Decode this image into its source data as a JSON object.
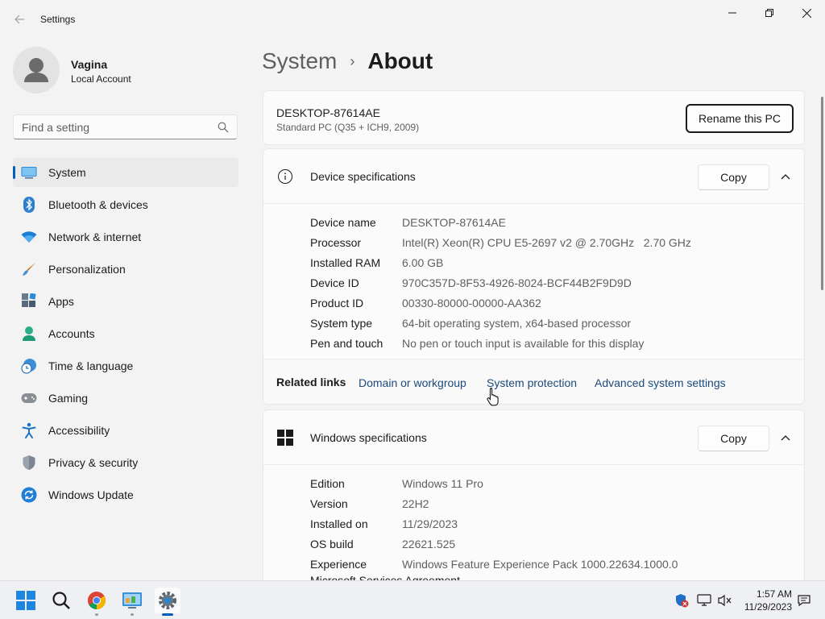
{
  "window": {
    "title": "Settings",
    "controls": {
      "minimize": "minimize-icon",
      "maximize": "restore-icon",
      "close": "close-icon"
    }
  },
  "profile": {
    "name": "Vagina",
    "account_type": "Local Account"
  },
  "search": {
    "placeholder": "Find a setting",
    "value": ""
  },
  "sidebar": {
    "items": [
      {
        "label": "System",
        "icon": "monitor-icon",
        "active": true
      },
      {
        "label": "Bluetooth & devices",
        "icon": "bluetooth-icon"
      },
      {
        "label": "Network & internet",
        "icon": "wifi-icon"
      },
      {
        "label": "Personalization",
        "icon": "brush-icon"
      },
      {
        "label": "Apps",
        "icon": "apps-icon"
      },
      {
        "label": "Accounts",
        "icon": "accounts-icon"
      },
      {
        "label": "Time & language",
        "icon": "globe-clock-icon"
      },
      {
        "label": "Gaming",
        "icon": "gamepad-icon"
      },
      {
        "label": "Accessibility",
        "icon": "accessibility-icon"
      },
      {
        "label": "Privacy & security",
        "icon": "shield-icon"
      },
      {
        "label": "Windows Update",
        "icon": "update-icon"
      }
    ]
  },
  "breadcrumb": {
    "parent": "System",
    "separator": "›",
    "current": "About"
  },
  "pc": {
    "name": "DESKTOP-87614AE",
    "model": "Standard PC (Q35 + ICH9, 2009)",
    "rename_label": "Rename this PC"
  },
  "device_specs": {
    "title": "Device specifications",
    "copy_label": "Copy",
    "rows": [
      {
        "label": "Device name",
        "value": "DESKTOP-87614AE"
      },
      {
        "label": "Processor",
        "value": "Intel(R) Xeon(R) CPU E5-2697 v2 @ 2.70GHz   2.70 GHz"
      },
      {
        "label": "Installed RAM",
        "value": "6.00 GB"
      },
      {
        "label": "Device ID",
        "value": "970C357D-8F53-4926-8024-BCF44B2F9D9D"
      },
      {
        "label": "Product ID",
        "value": "00330-80000-00000-AA362"
      },
      {
        "label": "System type",
        "value": "64-bit operating system, x64-based processor"
      },
      {
        "label": "Pen and touch",
        "value": "No pen or touch input is available for this display"
      }
    ]
  },
  "related": {
    "label": "Related links",
    "links": [
      "Domain or workgroup",
      "System protection",
      "Advanced system settings"
    ]
  },
  "windows_specs": {
    "title": "Windows specifications",
    "copy_label": "Copy",
    "rows": [
      {
        "label": "Edition",
        "value": "Windows 11 Pro"
      },
      {
        "label": "Version",
        "value": "22H2"
      },
      {
        "label": "Installed on",
        "value": "11/29/2023"
      },
      {
        "label": "OS build",
        "value": "22621.525"
      },
      {
        "label": "Experience",
        "value": "Windows Feature Experience Pack 1000.22634.1000.0"
      }
    ],
    "partial_row": "Microsoft Services Agreement"
  },
  "taskbar": {
    "apps": [
      "start-icon",
      "search-icon",
      "chrome-icon",
      "control-panel-icon",
      "settings-icon"
    ],
    "time": "1:57 AM",
    "date": "11/29/2023"
  },
  "colors": {
    "accent": "#005fb8",
    "background": "#f3f3f3",
    "card": "#fbfbfb",
    "link": "#1b4a7a"
  }
}
